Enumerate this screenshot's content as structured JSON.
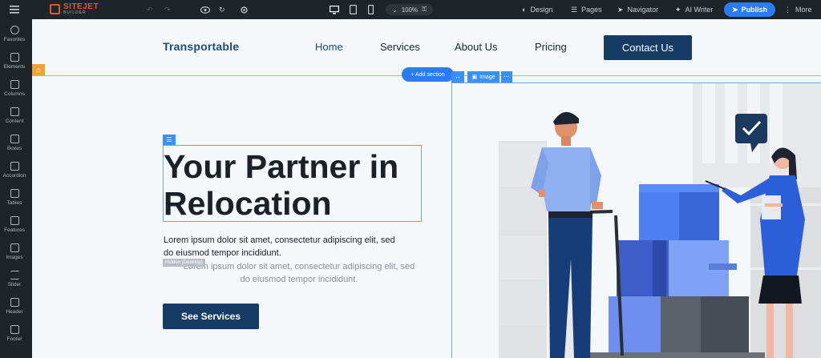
{
  "topbar": {
    "logo_name": "SITEJET",
    "logo_sub": "BUILDER",
    "zoom": "100%",
    "design": "Design",
    "pages": "Pages",
    "navigator": "Navigator",
    "ai_writer": "AI Writer",
    "publish": "Publish",
    "more": "More"
  },
  "sidebar": {
    "items": [
      {
        "label": "Favorites",
        "icon": "star-icon"
      },
      {
        "label": "Elements",
        "icon": "cube-icon"
      },
      {
        "label": "Columns",
        "icon": "columns-icon"
      },
      {
        "label": "Content",
        "icon": "document-icon"
      },
      {
        "label": "Boxes",
        "icon": "box-icon"
      },
      {
        "label": "Accordion",
        "icon": "accordion-icon"
      },
      {
        "label": "Tables",
        "icon": "table-icon"
      },
      {
        "label": "Features",
        "icon": "features-icon"
      },
      {
        "label": "Images",
        "icon": "image-icon"
      },
      {
        "label": "Slider",
        "icon": "slider-icon"
      },
      {
        "label": "Header",
        "icon": "header-icon"
      },
      {
        "label": "Footer",
        "icon": "footer-icon"
      }
    ]
  },
  "site": {
    "brand": "Transportable",
    "nav": {
      "home": "Home",
      "services": "Services",
      "about": "About Us",
      "pricing": "Pricing",
      "contact": "Contact Us"
    },
    "hero": {
      "heading": "Your Partner in Relocation",
      "paragraph": "Lorem ipsum dolor sit amet, consectetur adipiscing elit, sed do eiusmod tempor incididunt.",
      "hidden_tag": "Hidden (Desktop)",
      "paragraph_hidden": "Lorem ipsum dolor sit amet, consectetur adipiscing elit, sed do eiusmod tempor incididunt.",
      "button": "See Services"
    }
  },
  "editor": {
    "add_section": "+ Add section",
    "image_tag": "Image"
  },
  "colors": {
    "dark_ui": "#1f2428",
    "accent_blue": "#2b7cf4",
    "navy": "#163b64",
    "section_line": "#f2b04b"
  }
}
